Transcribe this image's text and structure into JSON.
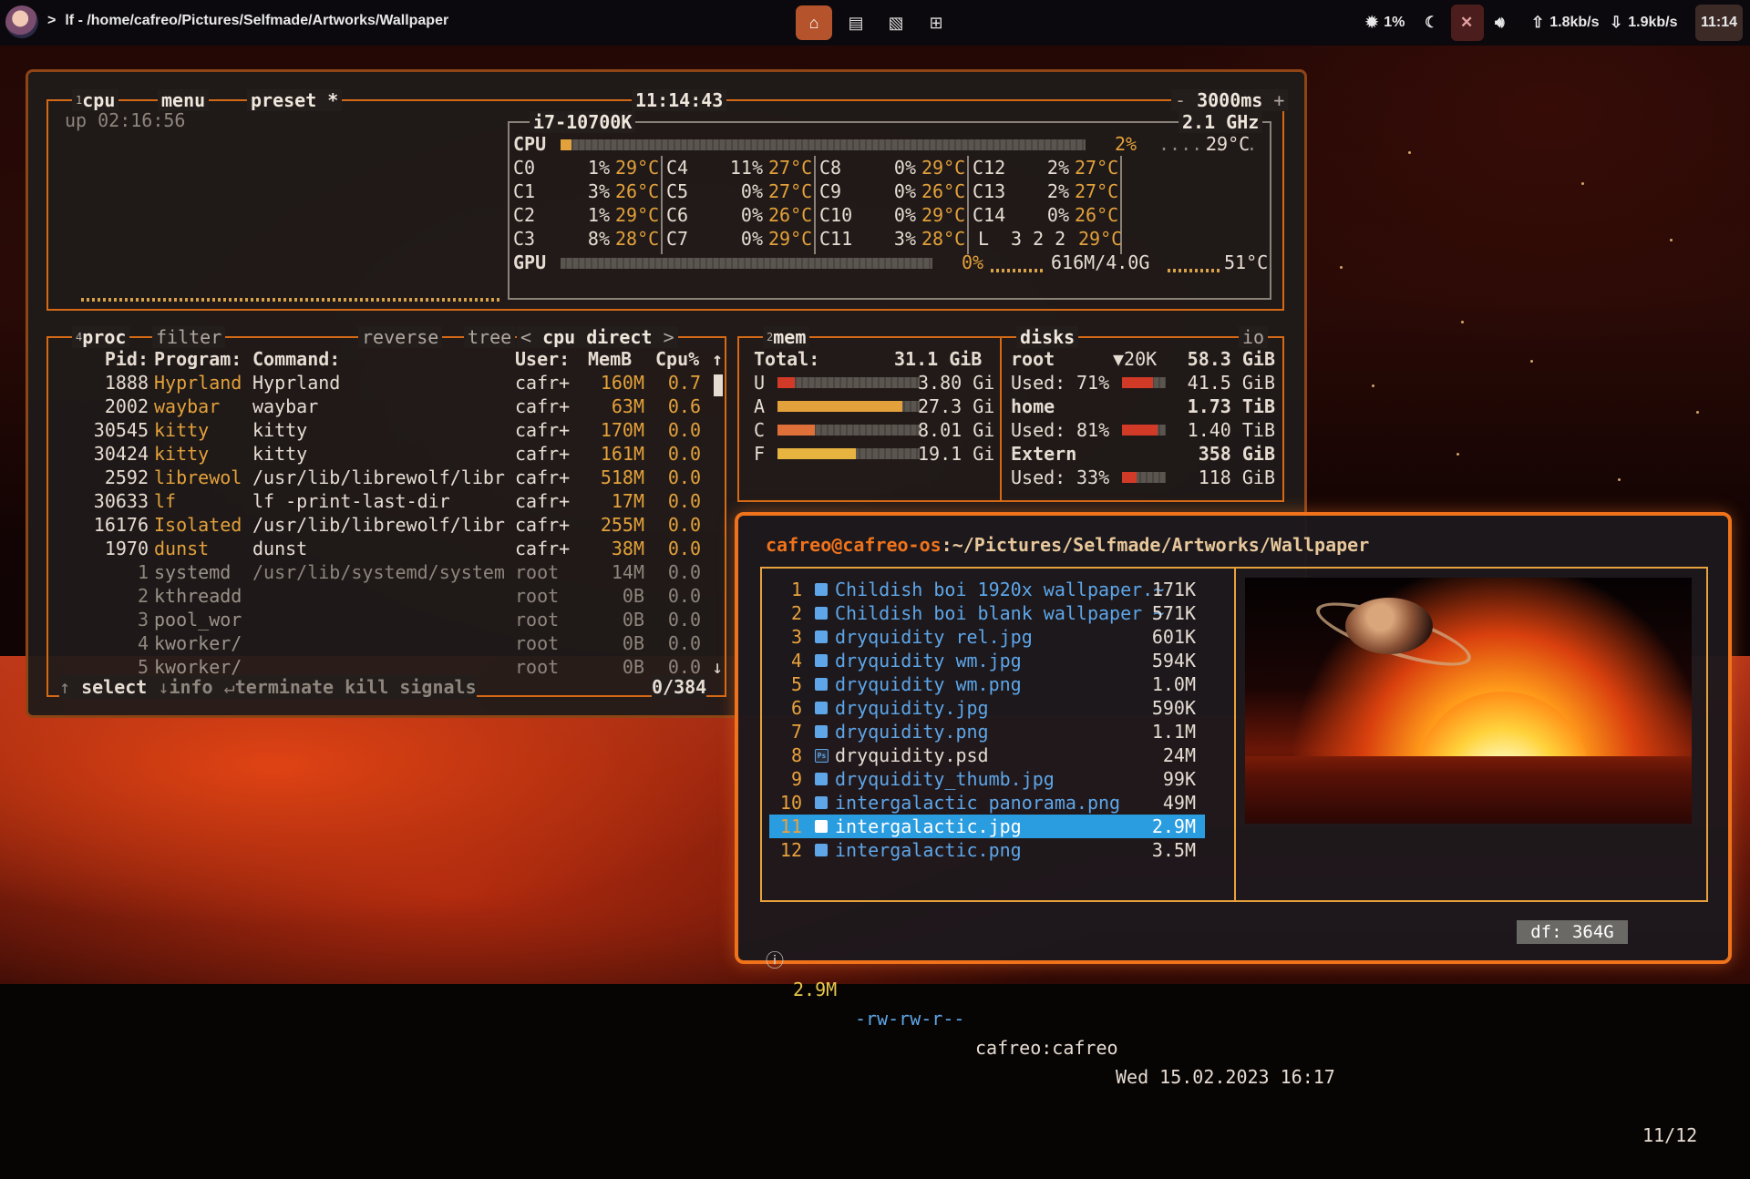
{
  "topbar": {
    "title": "lf - /home/cafreo/Pictures/Selfmade/Artworks/Wallpaper",
    "chevron": ">",
    "workspaces": [
      "⌂",
      "▤",
      "▧",
      "⊞"
    ],
    "cpu": "1%",
    "net_up": "1.8kb/s",
    "net_down": "1.9kb/s",
    "clock": "11:14"
  },
  "btop": {
    "cpu_box": {
      "label_num": "1",
      "label": "cpu",
      "menu": "menu",
      "preset": "preset *",
      "clock": "11:14:43",
      "interval": "3000ms",
      "minus": "-",
      "plus": "+",
      "uptime": "up 02:16:56",
      "model": "i7-10700K",
      "freq": "2.1 GHz",
      "cpu_label": "CPU",
      "cpu_pct": "2%",
      "cpu_temp": "29°C",
      "cpu_usage": 0.02,
      "cores": [
        [
          "C0",
          "1%",
          "29°C"
        ],
        [
          "C1",
          "3%",
          "26°C"
        ],
        [
          "C2",
          "1%",
          "29°C"
        ],
        [
          "C3",
          "8%",
          "28°C"
        ],
        [
          "C4",
          "11%",
          "27°C"
        ],
        [
          "C5",
          "0%",
          "27°C"
        ],
        [
          "C6",
          "0%",
          "26°C"
        ],
        [
          "C7",
          "0%",
          "29°C"
        ],
        [
          "C8",
          "0%",
          "29°C"
        ],
        [
          "C9",
          "0%",
          "26°C"
        ],
        [
          "C10",
          "0%",
          "29°C"
        ],
        [
          "C11",
          "3%",
          "28°C"
        ],
        [
          "C12",
          "2%",
          "27°C"
        ],
        [
          "C13",
          "2%",
          "27°C"
        ],
        [
          "C14",
          "0%",
          "26°C"
        ]
      ],
      "load_label": "L",
      "load": "3 2 2",
      "load_temp": "29°C",
      "gpu_label": "GPU",
      "gpu_pct": "0%",
      "gpu_mem": "616M/4.0G",
      "gpu_temp": "51°C"
    },
    "proc_box": {
      "label_num": "4",
      "label": "proc",
      "filter": "filter",
      "reverse": "reverse",
      "tree": "tree",
      "sort_left": "<",
      "sort": "cpu direct",
      "sort_right": ">",
      "headers": [
        "Pid:",
        "Program:",
        "Command:",
        "User:",
        "MemB",
        "Cpu%"
      ],
      "up_arrow": "↑",
      "down_arrow": "↓",
      "rows": [
        [
          "1888",
          "Hyprland",
          "Hyprland",
          "cafr+",
          "160M",
          "0.7"
        ],
        [
          "2002",
          "waybar",
          "waybar",
          "cafr+",
          "63M",
          "0.6"
        ],
        [
          "30545",
          "kitty",
          "kitty",
          "cafr+",
          "170M",
          "0.0"
        ],
        [
          "30424",
          "kitty",
          "kitty",
          "cafr+",
          "161M",
          "0.0"
        ],
        [
          "2592",
          "librewol",
          "/usr/lib/librewolf/libr",
          "cafr+",
          "518M",
          "0.0"
        ],
        [
          "30633",
          "lf",
          "lf -print-last-dir",
          "cafr+",
          "17M",
          "0.0"
        ],
        [
          "16176",
          "Isolated",
          "/usr/lib/librewolf/libr",
          "cafr+",
          "255M",
          "0.0"
        ],
        [
          "1970",
          "dunst",
          "dunst",
          "cafr+",
          "38M",
          "0.0"
        ],
        [
          "1",
          "systemd",
          "/usr/lib/systemd/system",
          "root",
          "14M",
          "0.0"
        ],
        [
          "2",
          "kthreadd",
          "",
          "root",
          "0B",
          "0.0"
        ],
        [
          "3",
          "pool_wor",
          "",
          "root",
          "0B",
          "0.0"
        ],
        [
          "4",
          "kworker/",
          "",
          "root",
          "0B",
          "0.0"
        ],
        [
          "5",
          "kworker/",
          "",
          "root",
          "0B",
          "0.0"
        ]
      ],
      "footer": {
        "select_arrow": "↑",
        "select": "select",
        "info_arrow": "↓",
        "info": "info",
        "terminate_arrow": "↵",
        "terminate": "terminate",
        "kill": "kill",
        "signals": "signals",
        "count": "0/384"
      }
    },
    "mem_box": {
      "label_num": "2",
      "label": "mem",
      "total_label": "Total:",
      "total": "31.1 GiB",
      "rows": [
        {
          "k": "U",
          "v": "3.80 Gi",
          "f": 0.12,
          "c": "#d23a28"
        },
        {
          "k": "A",
          "v": "27.3 Gi",
          "f": 0.88,
          "c": "#e3a13b"
        },
        {
          "k": "C",
          "v": "8.01 Gi",
          "f": 0.26,
          "c": "#e0703a"
        },
        {
          "k": "F",
          "v": "19.1 Gi",
          "f": 0.55,
          "c": "#e8b440"
        }
      ]
    },
    "disks_box": {
      "label": "disks",
      "io": "io",
      "disks": [
        {
          "name": "root",
          "extra": "▼20K",
          "size": "58.3 GiB",
          "used_label": "Used:",
          "used_pct": "71%",
          "used": "41.5 GiB",
          "f": 0.71
        },
        {
          "name": "home",
          "extra": "",
          "size": "1.73 TiB",
          "used_label": "Used:",
          "used_pct": "81%",
          "used": "1.40 TiB",
          "f": 0.81
        },
        {
          "name": "Extern",
          "extra": "",
          "size": "358 GiB",
          "used_label": "Used:",
          "used_pct": "33%",
          "used": "118 GiB",
          "f": 0.33
        }
      ]
    }
  },
  "lf": {
    "user_host": "cafreo@cafreo-os",
    "path": ":~/Pictures/Selfmade/Artworks/Wallpaper",
    "files": [
      {
        "n": "1",
        "name": "Childish boi 1920x wallpaper.~",
        "size": "171K",
        "type": "img"
      },
      {
        "n": "2",
        "name": "Childish boi blank wallpaper ~",
        "size": "571K",
        "type": "img"
      },
      {
        "n": "3",
        "name": "dryquidity rel.jpg",
        "size": "601K",
        "type": "img"
      },
      {
        "n": "4",
        "name": "dryquidity wm.jpg",
        "size": "594K",
        "type": "img"
      },
      {
        "n": "5",
        "name": "dryquidity wm.png",
        "size": "1.0M",
        "type": "img"
      },
      {
        "n": "6",
        "name": "dryquidity.jpg",
        "size": "590K",
        "type": "img"
      },
      {
        "n": "7",
        "name": "dryquidity.png",
        "size": "1.1M",
        "type": "img"
      },
      {
        "n": "8",
        "name": "dryquidity.psd",
        "size": "24M",
        "type": "psd"
      },
      {
        "n": "9",
        "name": "dryquidity_thumb.jpg",
        "size": "99K",
        "type": "img"
      },
      {
        "n": "10",
        "name": "intergalactic panorama.png",
        "size": "49M",
        "type": "img"
      },
      {
        "n": "11",
        "name": "intergalactic.jpg",
        "size": "2.9M",
        "type": "img",
        "selected": true
      },
      {
        "n": "12",
        "name": "intergalactic.png",
        "size": "3.5M",
        "type": "img"
      }
    ],
    "psd_icon_text": "Ps",
    "status": {
      "info_icon": "ⓘ",
      "size": "2.9M",
      "perms": "-rw-rw-r--",
      "owner": "cafreo:cafreo",
      "date": "Wed 15.02.2023 16:17",
      "df": "df: 364G",
      "pos": "11/12"
    }
  },
  "colors": {
    "accent": "#d56a16",
    "lf_border": "#f0731c",
    "file_blue": "#5ea6e8",
    "selection": "#2a9ce0",
    "workspace_active": "#b5532c"
  }
}
